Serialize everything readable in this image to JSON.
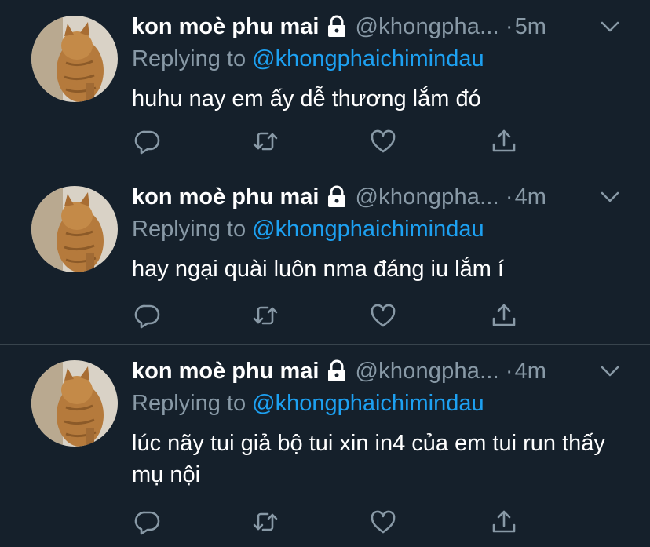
{
  "tweets": [
    {
      "display_name": "kon moè phu mai",
      "handle": "@khongpha...",
      "separator": "·",
      "time": "5m",
      "replying_label": "Replying to",
      "replying_to": "@khongphaichimindau",
      "text": "huhu nay em ấy dễ thương lắm đó"
    },
    {
      "display_name": "kon moè phu mai",
      "handle": "@khongpha...",
      "separator": "·",
      "time": "4m",
      "replying_label": "Replying to",
      "replying_to": "@khongphaichimindau",
      "text": "hay ngại quài luôn nma đáng iu lắm í"
    },
    {
      "display_name": "kon moè phu mai",
      "handle": "@khongpha...",
      "separator": "·",
      "time": "4m",
      "replying_label": "Replying to",
      "replying_to": "@khongphaichimindau",
      "text": "lúc nãy tui giả bộ tui xin in4 của em tui run thấy mụ nội"
    }
  ],
  "icons": {
    "lock": "lock-icon",
    "caret": "chevron-down-icon",
    "reply": "reply-icon",
    "retweet": "retweet-icon",
    "like": "heart-icon",
    "share": "share-icon"
  },
  "colors": {
    "background": "#15202b",
    "divider": "#38444d",
    "secondary_text": "#8899a6",
    "mention": "#1da1f2",
    "primary_text": "#ffffff"
  }
}
